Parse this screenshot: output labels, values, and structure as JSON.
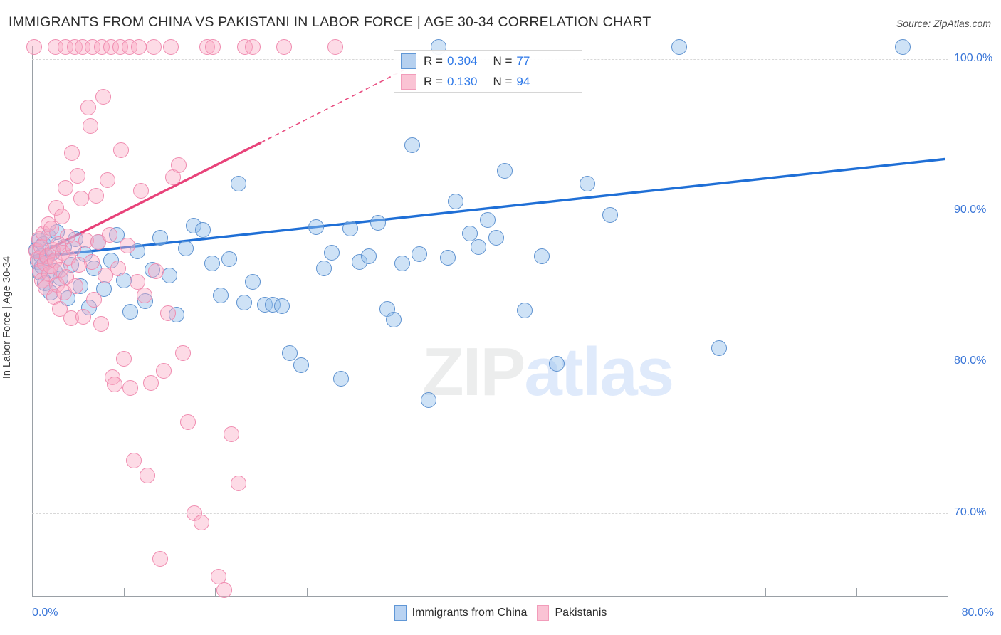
{
  "header": {
    "title": "IMMIGRANTS FROM CHINA VS PAKISTANI IN LABOR FORCE | AGE 30-34 CORRELATION CHART",
    "source": "Source: ZipAtlas.com"
  },
  "watermark": {
    "part1": "ZIP",
    "part2": "atlas"
  },
  "stats": {
    "rows": [
      {
        "series": "Immigrants from China",
        "r_label": "R =",
        "r_value": "0.304",
        "n_label": "N =",
        "n_value": "77",
        "color": "#b5d0ef"
      },
      {
        "series": "Pakistanis",
        "r_label": "R =",
        "r_value": "0.130",
        "n_label": "N =",
        "n_value": "94",
        "color": "#fac3d4"
      }
    ]
  },
  "axes": {
    "y_title": "In Labor Force | Age 30-34",
    "y_ticks": [
      "100.0%",
      "90.0%",
      "80.0%",
      "70.0%"
    ],
    "x_min_label": "0.0%",
    "x_max_label": "80.0%"
  },
  "legend": {
    "items": [
      {
        "label": "Immigrants from China",
        "color": "#b9d3f2"
      },
      {
        "label": "Pakistanis",
        "color": "#fac3d4"
      }
    ]
  },
  "chart_data": {
    "type": "scatter",
    "title": "IMMIGRANTS FROM CHINA VS PAKISTANI IN LABOR FORCE | AGE 30-34 CORRELATION CHART",
    "xlabel": "",
    "ylabel": "In Labor Force | Age 30-34",
    "xlim": [
      0,
      80
    ],
    "ylim": [
      64.5,
      100.9
    ],
    "x_ticks": [
      0,
      80
    ],
    "y_ticks": [
      70,
      80,
      90,
      100
    ],
    "grid": "horizontal-dashed",
    "legend_position": "bottom-center",
    "series": [
      {
        "name": "Immigrants from China",
        "color": "#b5d0ef",
        "border_color": "#5e92d0",
        "R": 0.304,
        "N": 77,
        "trendline": {
          "x0": 0.0,
          "y0": 86.9,
          "x1": 79.7,
          "y1": 93.4,
          "style": "solid"
        },
        "points": [
          [
            0.35,
            87.4
          ],
          [
            0.5,
            86.6
          ],
          [
            0.6,
            88.0
          ],
          [
            0.7,
            85.9
          ],
          [
            0.8,
            87.0
          ],
          [
            0.9,
            86.3
          ],
          [
            1.0,
            87.8
          ],
          [
            1.1,
            85.2
          ],
          [
            1.3,
            86.9
          ],
          [
            1.4,
            88.3
          ],
          [
            1.6,
            84.6
          ],
          [
            1.8,
            87.2
          ],
          [
            2.0,
            86.0
          ],
          [
            2.2,
            88.6
          ],
          [
            2.5,
            85.5
          ],
          [
            2.8,
            87.6
          ],
          [
            3.1,
            84.2
          ],
          [
            3.4,
            86.4
          ],
          [
            3.8,
            88.1
          ],
          [
            4.2,
            85.0
          ],
          [
            4.6,
            87.1
          ],
          [
            5.0,
            83.6
          ],
          [
            5.4,
            86.2
          ],
          [
            5.8,
            87.9
          ],
          [
            6.3,
            84.8
          ],
          [
            6.9,
            86.7
          ],
          [
            7.4,
            88.4
          ],
          [
            8.0,
            85.4
          ],
          [
            8.6,
            83.3
          ],
          [
            9.2,
            87.3
          ],
          [
            9.9,
            84.0
          ],
          [
            10.5,
            86.1
          ],
          [
            11.2,
            88.2
          ],
          [
            12.0,
            85.7
          ],
          [
            12.6,
            83.1
          ],
          [
            13.4,
            87.5
          ],
          [
            14.1,
            89.0
          ],
          [
            14.9,
            88.7
          ],
          [
            15.7,
            86.5
          ],
          [
            16.5,
            84.4
          ],
          [
            17.2,
            86.8
          ],
          [
            18.0,
            91.8
          ],
          [
            18.5,
            83.9
          ],
          [
            19.3,
            85.3
          ],
          [
            20.3,
            83.8
          ],
          [
            21.0,
            83.8
          ],
          [
            21.8,
            83.7
          ],
          [
            22.5,
            80.6
          ],
          [
            23.5,
            79.8
          ],
          [
            24.8,
            88.9
          ],
          [
            25.5,
            86.2
          ],
          [
            26.2,
            87.2
          ],
          [
            27.0,
            78.9
          ],
          [
            27.8,
            88.8
          ],
          [
            28.6,
            86.6
          ],
          [
            29.4,
            87.0
          ],
          [
            30.2,
            89.2
          ],
          [
            31.0,
            83.5
          ],
          [
            31.6,
            82.8
          ],
          [
            32.3,
            86.5
          ],
          [
            33.2,
            94.3
          ],
          [
            33.8,
            87.1
          ],
          [
            34.6,
            77.5
          ],
          [
            35.5,
            100.8
          ],
          [
            36.3,
            86.9
          ],
          [
            37.0,
            90.6
          ],
          [
            38.2,
            88.5
          ],
          [
            39.0,
            87.6
          ],
          [
            39.8,
            89.4
          ],
          [
            40.5,
            88.2
          ],
          [
            41.3,
            92.6
          ],
          [
            43.0,
            83.4
          ],
          [
            44.5,
            87.0
          ],
          [
            45.8,
            79.9
          ],
          [
            48.5,
            91.8
          ],
          [
            50.5,
            89.7
          ],
          [
            56.5,
            100.8
          ],
          [
            60.0,
            80.9
          ],
          [
            76.0,
            100.8
          ]
        ]
      },
      {
        "name": "Pakistanis",
        "color": "#fac3d4",
        "border_color": "#f08cb0",
        "R": 0.13,
        "N": 94,
        "trendline": {
          "x0": 0.0,
          "y0": 86.9,
          "x1": 20.0,
          "y1": 94.5,
          "style": "solid",
          "dashed_extension": {
            "x1": 32.5,
            "y1": 99.3
          }
        },
        "points": [
          [
            0.2,
            100.8
          ],
          [
            0.4,
            87.3
          ],
          [
            0.5,
            86.8
          ],
          [
            0.6,
            88.1
          ],
          [
            0.7,
            86.0
          ],
          [
            0.8,
            87.6
          ],
          [
            0.9,
            85.4
          ],
          [
            1.0,
            88.5
          ],
          [
            1.1,
            86.5
          ],
          [
            1.2,
            84.9
          ],
          [
            1.3,
            87.0
          ],
          [
            1.4,
            89.1
          ],
          [
            1.5,
            85.8
          ],
          [
            1.6,
            86.3
          ],
          [
            1.7,
            88.8
          ],
          [
            1.8,
            87.4
          ],
          [
            1.9,
            84.3
          ],
          [
            2.0,
            86.7
          ],
          [
            2.1,
            90.2
          ],
          [
            2.2,
            85.1
          ],
          [
            2.3,
            87.8
          ],
          [
            2.4,
            83.5
          ],
          [
            2.5,
            86.1
          ],
          [
            2.6,
            89.6
          ],
          [
            2.7,
            87.2
          ],
          [
            2.8,
            84.6
          ],
          [
            2.9,
            91.5
          ],
          [
            3.0,
            85.6
          ],
          [
            3.1,
            88.3
          ],
          [
            3.2,
            86.9
          ],
          [
            3.4,
            82.9
          ],
          [
            3.5,
            93.8
          ],
          [
            3.6,
            87.5
          ],
          [
            3.8,
            85.0
          ],
          [
            4.0,
            92.3
          ],
          [
            4.1,
            86.4
          ],
          [
            4.3,
            90.8
          ],
          [
            4.5,
            83.0
          ],
          [
            4.7,
            88.0
          ],
          [
            4.9,
            96.8
          ],
          [
            5.1,
            95.6
          ],
          [
            5.2,
            86.6
          ],
          [
            5.4,
            84.1
          ],
          [
            5.6,
            91.0
          ],
          [
            5.8,
            87.9
          ],
          [
            6.0,
            82.5
          ],
          [
            6.2,
            97.5
          ],
          [
            6.4,
            85.7
          ],
          [
            6.6,
            92.0
          ],
          [
            6.8,
            88.4
          ],
          [
            7.0,
            79.0
          ],
          [
            7.2,
            78.5
          ],
          [
            7.5,
            86.2
          ],
          [
            7.8,
            94.0
          ],
          [
            8.0,
            80.2
          ],
          [
            8.3,
            87.7
          ],
          [
            8.6,
            78.3
          ],
          [
            8.9,
            73.5
          ],
          [
            9.2,
            85.3
          ],
          [
            9.5,
            91.3
          ],
          [
            9.8,
            84.4
          ],
          [
            10.1,
            72.5
          ],
          [
            10.4,
            78.6
          ],
          [
            10.8,
            86.0
          ],
          [
            11.2,
            67.0
          ],
          [
            11.5,
            79.4
          ],
          [
            11.9,
            83.2
          ],
          [
            12.3,
            92.2
          ],
          [
            12.8,
            93.0
          ],
          [
            13.2,
            80.6
          ],
          [
            13.6,
            76.0
          ],
          [
            14.2,
            70.0
          ],
          [
            14.8,
            69.4
          ],
          [
            15.3,
            100.8
          ],
          [
            15.8,
            100.8
          ],
          [
            16.3,
            65.8
          ],
          [
            16.8,
            64.9
          ],
          [
            17.4,
            75.2
          ],
          [
            18.0,
            72.0
          ],
          [
            18.6,
            100.8
          ],
          [
            19.3,
            100.8
          ],
          [
            2.05,
            100.8
          ],
          [
            2.9,
            100.8
          ],
          [
            3.7,
            100.8
          ],
          [
            4.4,
            100.8
          ],
          [
            5.3,
            100.8
          ],
          [
            6.1,
            100.8
          ],
          [
            6.9,
            100.8
          ],
          [
            7.7,
            100.8
          ],
          [
            8.5,
            100.8
          ],
          [
            9.3,
            100.8
          ],
          [
            10.6,
            100.8
          ],
          [
            12.1,
            100.8
          ],
          [
            22.0,
            100.8
          ],
          [
            26.5,
            100.8
          ]
        ]
      }
    ]
  }
}
